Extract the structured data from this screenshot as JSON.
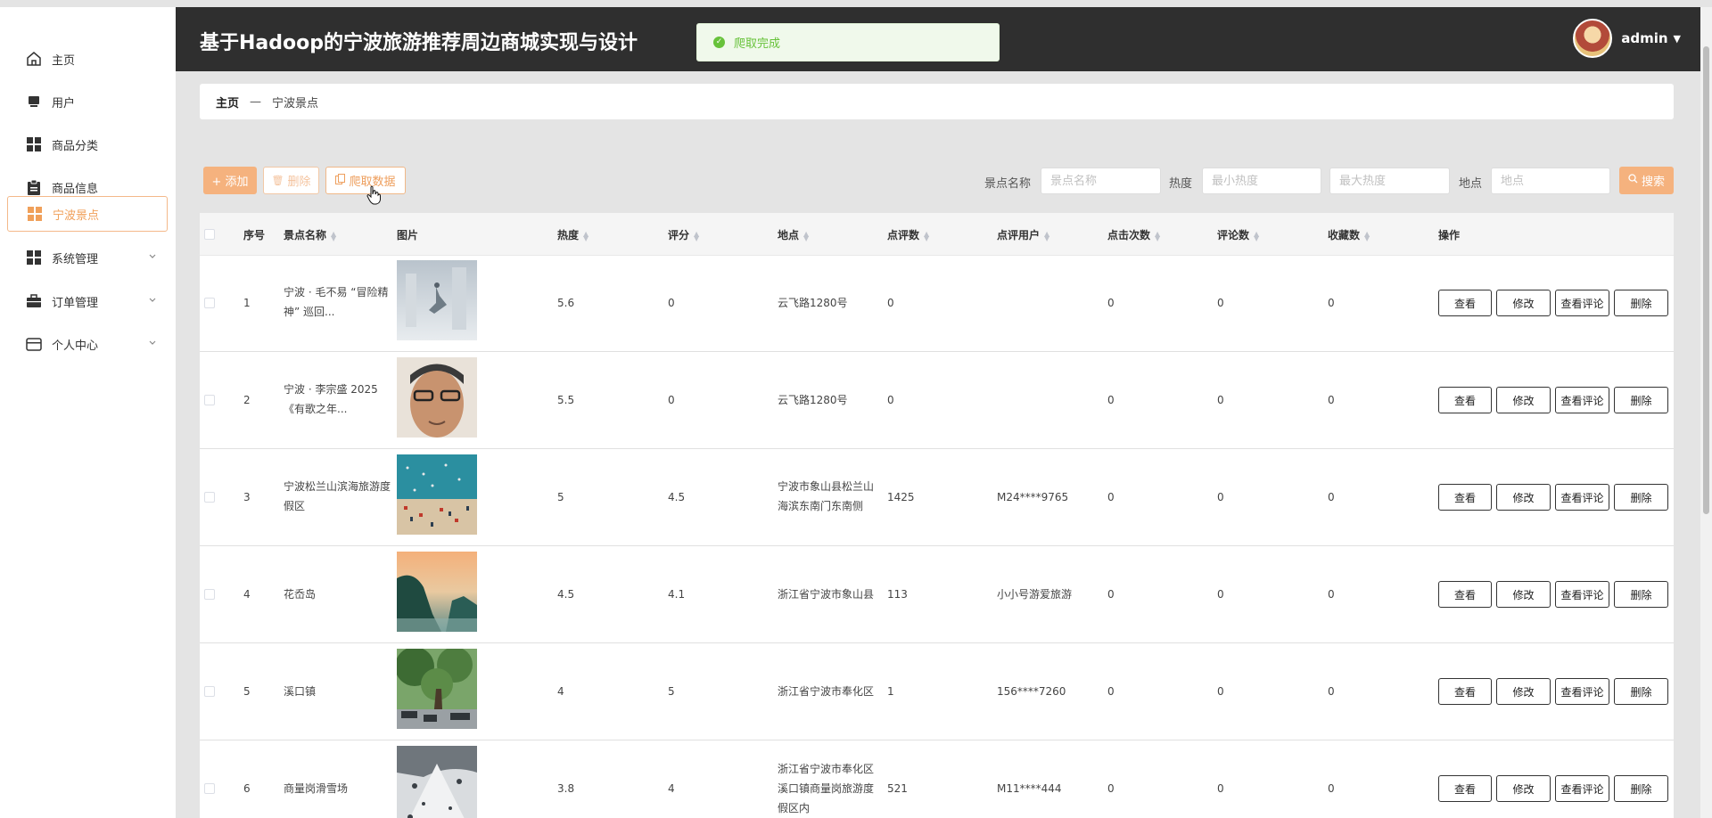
{
  "app": {
    "title": "基于Hadoop的宁波旅游推荐周边商城实现与设计"
  },
  "toast": {
    "text": "爬取完成",
    "color": "#67c23a"
  },
  "user": {
    "name": "admin"
  },
  "colors": {
    "accent": "#f5b27e",
    "header": "#2f2f2f"
  },
  "sidebar": {
    "items": [
      {
        "label": "主页",
        "icon": "home-icon"
      },
      {
        "label": "用户",
        "icon": "user-icon"
      },
      {
        "label": "商品分类",
        "icon": "grid-icon"
      },
      {
        "label": "商品信息",
        "icon": "clipboard-icon"
      },
      {
        "label": "宁波景点",
        "icon": "grid-icon",
        "active": true
      },
      {
        "label": "系统管理",
        "icon": "grid-icon",
        "has_children": true
      },
      {
        "label": "订单管理",
        "icon": "briefcase-icon",
        "has_children": true
      },
      {
        "label": "个人中心",
        "icon": "wallet-icon",
        "has_children": true
      }
    ]
  },
  "breadcrumb": {
    "home": "主页",
    "sep": "—",
    "current": "宁波景点"
  },
  "toolbar": {
    "add": "+ 添加",
    "delete": "删除",
    "crawl": "爬取数据",
    "search": "搜索"
  },
  "filters": {
    "name_label": "景点名称",
    "name_placeholder": "景点名称",
    "heat_label": "热度",
    "heat_min_placeholder": "最小热度",
    "heat_max_placeholder": "最大热度",
    "place_label": "地点",
    "place_placeholder": "地点"
  },
  "table": {
    "headers": [
      "序号",
      "景点名称",
      "图片",
      "热度",
      "评分",
      "地点",
      "点评数",
      "点评用户",
      "点击次数",
      "评论数",
      "收藏数",
      "操作"
    ],
    "actions": [
      "查看",
      "修改",
      "查看评论",
      "删除"
    ],
    "rows": [
      {
        "idx": "1",
        "name": "宁波 · 毛不易 “冒险精神” 巡回...",
        "heat": "5.6",
        "score": "0",
        "place": "云飞路1280号",
        "reviews": "0",
        "reviewer": "",
        "clicks": "0",
        "comments": "0",
        "favs": "0",
        "image": "misty-figure"
      },
      {
        "idx": "2",
        "name": "宁波 · 李宗盛 2025《有歌之年...",
        "heat": "5.5",
        "score": "0",
        "place": "云飞路1280号",
        "reviews": "0",
        "reviewer": "",
        "clicks": "0",
        "comments": "0",
        "favs": "0",
        "image": "portrait"
      },
      {
        "idx": "3",
        "name": "宁波松兰山滨海旅游度假区",
        "heat": "5",
        "score": "4.5",
        "place": "宁波市象山县松兰山海滨东南门东南侧",
        "reviews": "1425",
        "reviewer": "M24****9765",
        "clicks": "0",
        "comments": "0",
        "favs": "0",
        "image": "beach"
      },
      {
        "idx": "4",
        "name": "花岙岛",
        "heat": "4.5",
        "score": "4.1",
        "place": "浙江省宁波市象山县",
        "reviews": "113",
        "reviewer": "小小号游爱旅游",
        "clicks": "0",
        "comments": "0",
        "favs": "0",
        "image": "island"
      },
      {
        "idx": "5",
        "name": "溪口镇",
        "heat": "4",
        "score": "5",
        "place": "浙江省宁波市奉化区",
        "reviews": "1",
        "reviewer": "156****7260",
        "clicks": "0",
        "comments": "0",
        "favs": "0",
        "image": "town"
      },
      {
        "idx": "6",
        "name": "商量岗滑雪场",
        "heat": "3.8",
        "score": "4",
        "place": "浙江省宁波市奉化区溪口镇商量岗旅游度假区内",
        "reviews": "521",
        "reviewer": "M11****444",
        "clicks": "0",
        "comments": "0",
        "favs": "0",
        "image": "snow"
      }
    ]
  }
}
